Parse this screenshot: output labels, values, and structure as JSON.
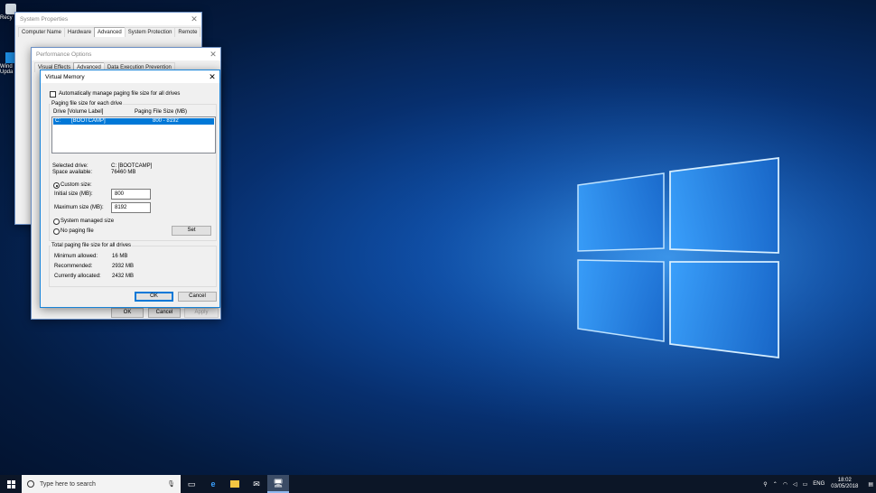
{
  "desktop": {
    "icons": [
      {
        "name": "recycle-bin-icon",
        "label": "Recy"
      },
      {
        "name": "windows-update-icon",
        "label": "Wind Upda"
      }
    ],
    "accent": "#0078d7"
  },
  "system_properties": {
    "title": "System Properties",
    "tabs": [
      "Computer Name",
      "Hardware",
      "Advanced",
      "System Protection",
      "Remote"
    ],
    "selected_tab": "Advanced"
  },
  "performance_options": {
    "title": "Performance Options",
    "tabs": [
      "Visual Effects",
      "Advanced",
      "Data Execution Prevention"
    ],
    "buttons": {
      "ok": "OK",
      "cancel": "Cancel",
      "apply": "Apply"
    }
  },
  "virtual_memory": {
    "title": "Virtual Memory",
    "auto_manage_label": "Automatically manage paging file size for all drives",
    "auto_manage_checked": false,
    "group_label": "Paging file size for each drive",
    "columns": [
      "Drive  [Volume Label]",
      "Paging File Size (MB)"
    ],
    "drives": [
      {
        "drive": "C:",
        "label": "[BOOTCAMP]",
        "size": "800 - 8192",
        "selected": true
      }
    ],
    "selected_drive_label": "Selected drive:",
    "selected_drive_value": "C:  [BOOTCAMP]",
    "space_available_label": "Space available:",
    "space_available_value": "76460 MB",
    "custom_size_label": "Custom size:",
    "initial_size_label": "Initial size (MB):",
    "initial_size_value": "800",
    "maximum_size_label": "Maximum size (MB):",
    "maximum_size_value": "8192",
    "system_managed_label": "System managed size",
    "no_paging_label": "No paging file",
    "selected_option": "custom",
    "set_label": "Set",
    "totals_label": "Total paging file size for all drives",
    "minimum_allowed_label": "Minimum allowed:",
    "minimum_allowed_value": "16 MB",
    "recommended_label": "Recommended:",
    "recommended_value": "2932 MB",
    "currently_allocated_label": "Currently allocated:",
    "currently_allocated_value": "2432 MB",
    "ok_label": "OK",
    "cancel_label": "Cancel"
  },
  "taskbar": {
    "search_placeholder": "Type here to search",
    "language": "ENG",
    "time": "18:02",
    "date": "03/05/2018"
  }
}
